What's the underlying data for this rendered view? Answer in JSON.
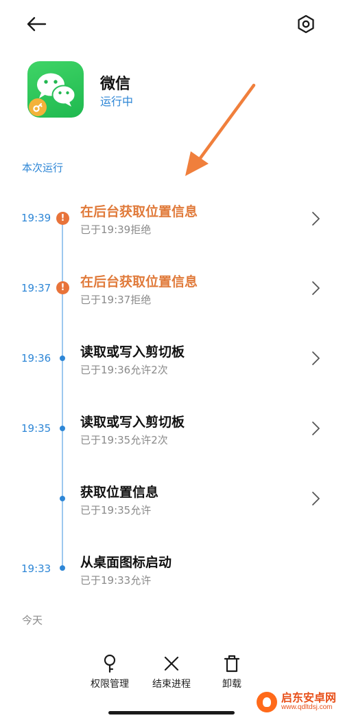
{
  "app": {
    "name": "微信",
    "status": "运行中"
  },
  "sections": {
    "current_run": "本次运行",
    "today": "今天"
  },
  "events": [
    {
      "time": "19:39",
      "title": "在后台获取位置信息",
      "detail": "已于19:39拒绝",
      "state": "denied",
      "has_chevron": true
    },
    {
      "time": "19:37",
      "title": "在后台获取位置信息",
      "detail": "已于19:37拒绝",
      "state": "denied",
      "has_chevron": true
    },
    {
      "time": "19:36",
      "title": "读取或写入剪切板",
      "detail": "已于19:36允许2次",
      "state": "allowed",
      "has_chevron": true
    },
    {
      "time": "19:35",
      "title": "读取或写入剪切板",
      "detail": "已于19:35允许2次",
      "state": "allowed",
      "has_chevron": true
    },
    {
      "time": "",
      "title": "获取位置信息",
      "detail": "已于19:35允许",
      "state": "allowed",
      "has_chevron": true
    },
    {
      "time": "19:33",
      "title": "从桌面图标启动",
      "detail": "已于19:33允许",
      "state": "allowed",
      "has_chevron": false
    }
  ],
  "toolbar": {
    "permissions_label": "权限管理",
    "end_process_label": "结束进程",
    "uninstall_label": "卸载"
  },
  "icons": {
    "back": "arrow-left-icon",
    "settings": "hexagon-gear-icon",
    "app": "wechat-icon",
    "warning": "exclamation-icon",
    "chevron": "chevron-right-icon",
    "permissions": "key-icon",
    "end_process": "close-x-icon",
    "uninstall": "trash-icon"
  },
  "colors": {
    "accent": "#2d86d6",
    "denied": "#e07a3a",
    "arrow_annotation": "#f07f3c",
    "app_green": "#2ac45a"
  },
  "watermark": {
    "name": "启东安卓网",
    "url": "www.qdltdsj.com"
  }
}
